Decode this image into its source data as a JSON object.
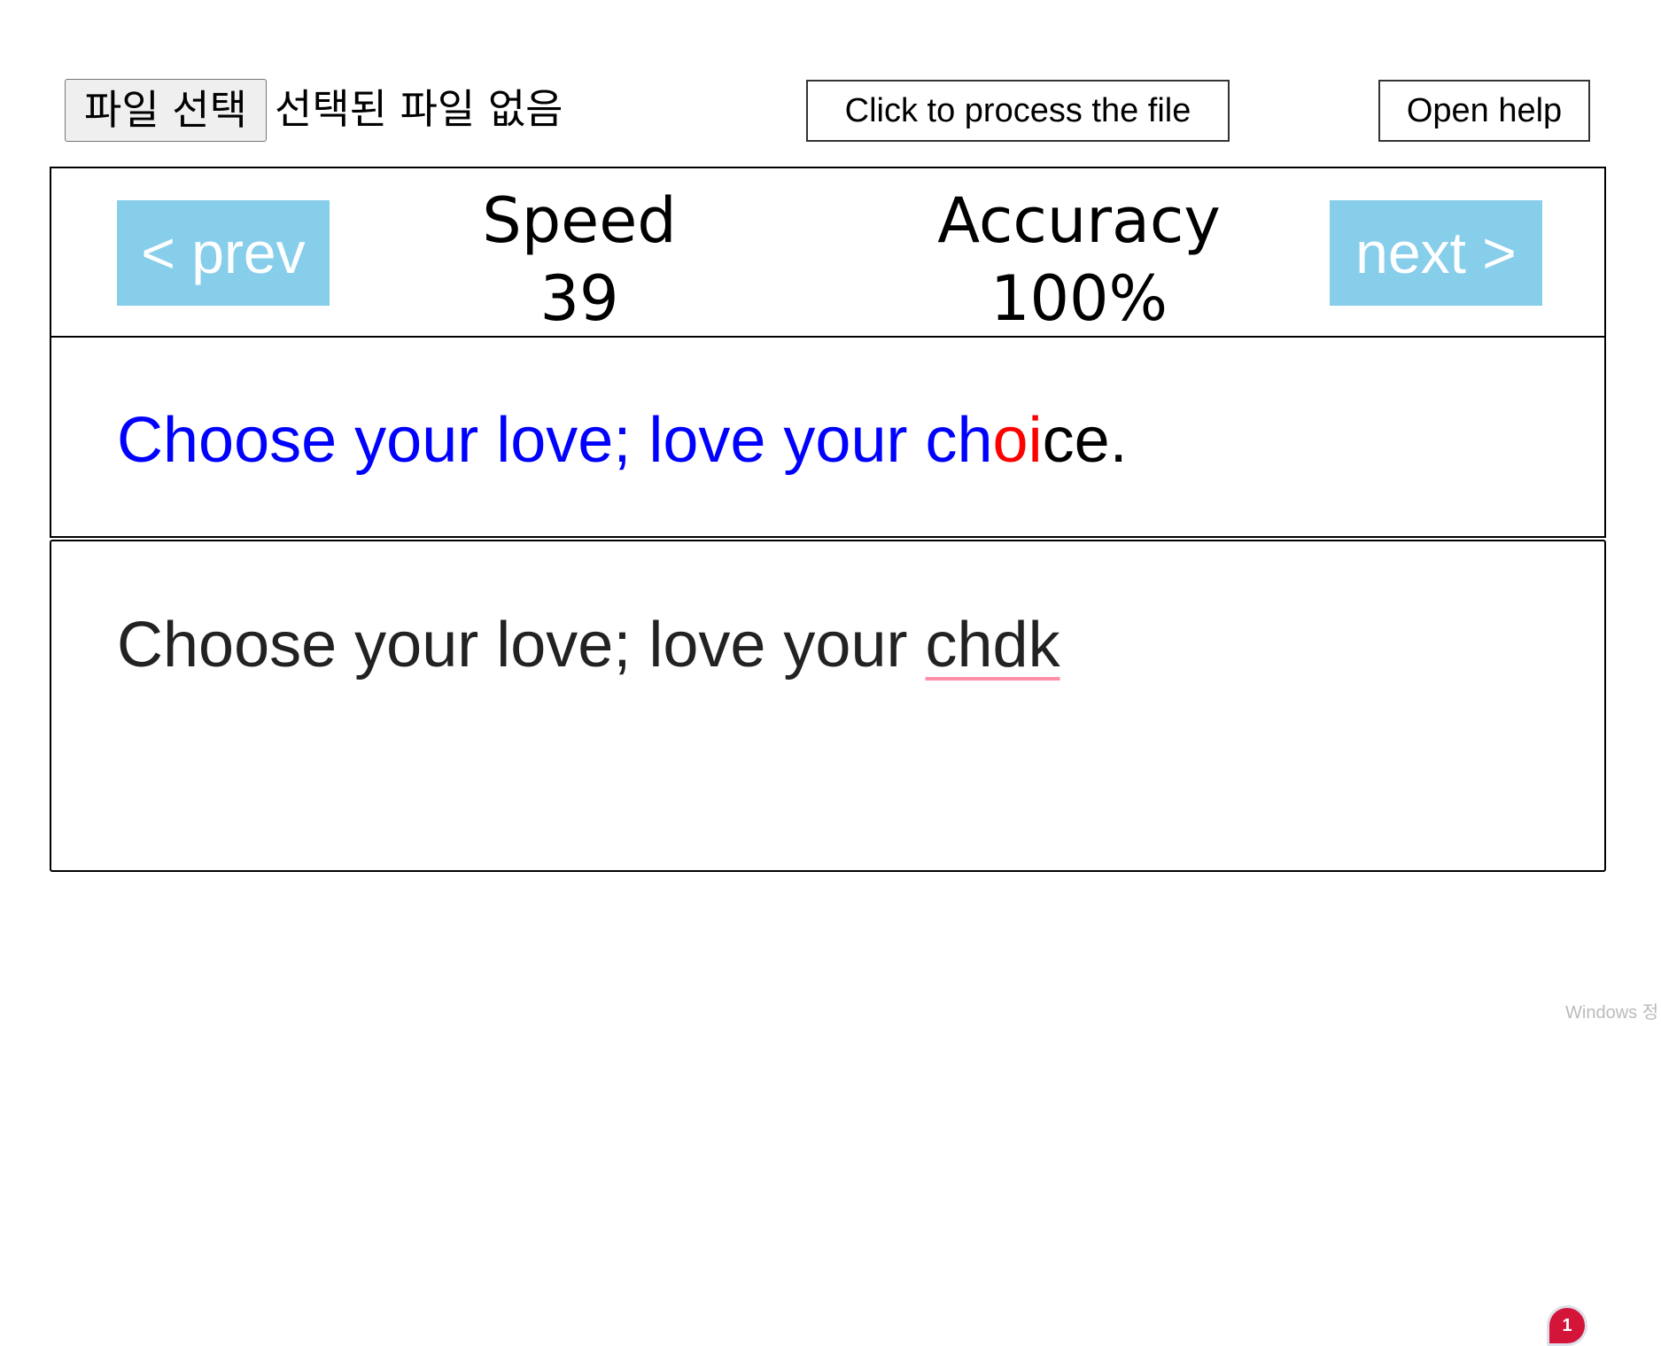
{
  "toolbar": {
    "choose_file_label": "파일 선택",
    "file_status": "선택된 파일 없음",
    "process_label": "Click to process the file",
    "help_label": "Open help"
  },
  "stats": {
    "prev_label": "< prev",
    "next_label": "next >",
    "speed_label": "Speed",
    "speed_value": "39",
    "accuracy_label": "Accuracy",
    "accuracy_value": "100%",
    "nav_color": "#87ceeb"
  },
  "target": {
    "typed": "Choose your love; love your ch",
    "error": "oi",
    "remaining": "ce.",
    "typed_color": "#0000ff",
    "error_color": "#ff0000"
  },
  "input": {
    "prefix": "Choose your love; love your ",
    "misspelled": "chdk"
  },
  "badge": {
    "count": "1",
    "color": "#d4153a"
  },
  "watermark": {
    "text": "Windows 정"
  }
}
